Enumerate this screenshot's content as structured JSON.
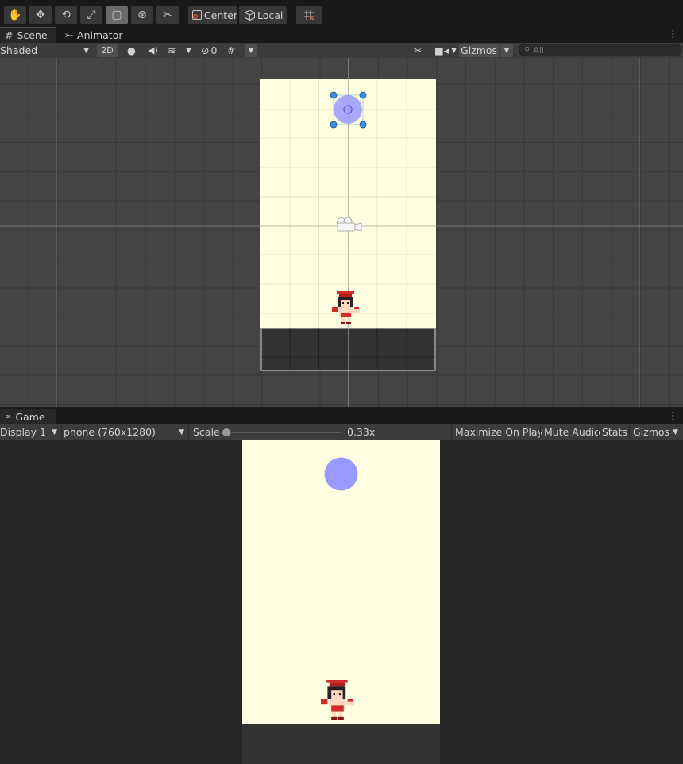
{
  "toolbar": {
    "tools": [
      {
        "name": "hand-tool",
        "glyph": "✋"
      },
      {
        "name": "move-tool",
        "glyph": "✥"
      },
      {
        "name": "rotate-tool",
        "glyph": "⟲"
      },
      {
        "name": "scale-tool",
        "glyph": "⤢"
      },
      {
        "name": "rect-tool",
        "glyph": "▢"
      },
      {
        "name": "transform-tool",
        "glyph": "⊛"
      },
      {
        "name": "custom-tool",
        "glyph": "✂"
      }
    ],
    "active_tool": "rect-tool",
    "pivot_mode": "Center",
    "pivot_rotation": "Local"
  },
  "scene_panel": {
    "tabs": [
      {
        "label": "Scene",
        "glyph": "#"
      },
      {
        "label": "Animator",
        "glyph": "⤜"
      }
    ],
    "shading_mode": "Shaded",
    "mode_2d": "2D",
    "hidden_count": "0",
    "gizmos_label": "Gizmos",
    "search_placeholder": "All"
  },
  "game_panel": {
    "tab_label": "Game",
    "display": "Display 1",
    "resolution": "phone (760x1280)",
    "scale_label": "Scale",
    "scale_value": "0.33x",
    "scale_fraction": 0.0,
    "maximize_label": "Maximize On Play",
    "mute_label": "Mute Audio",
    "stats_label": "Stats",
    "gizmos_label": "Gizmos"
  },
  "colors": {
    "background_tint": "#fffee0",
    "ground": "#333333",
    "circle": "#9999ff",
    "selection_handle": "#3d8fe0"
  }
}
